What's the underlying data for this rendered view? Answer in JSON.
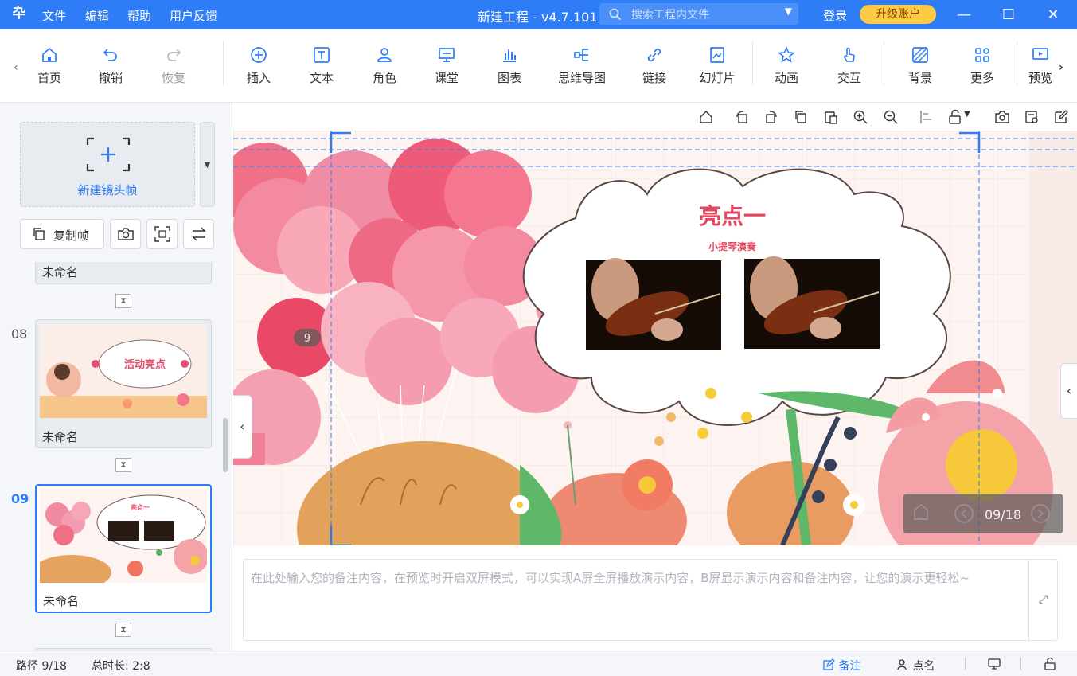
{
  "titlebar": {
    "logo": "卆",
    "menus": [
      "文件",
      "编辑",
      "帮助",
      "用户反馈"
    ],
    "title": "新建工程 - v4.7.101",
    "search_placeholder": "搜索工程内文件",
    "login": "登录",
    "upgrade": "升级账户",
    "accent": "#2e7cf6"
  },
  "toolbar": {
    "items": [
      {
        "label": "首页",
        "icon": "home-icon"
      },
      {
        "label": "撤销",
        "icon": "undo-icon"
      },
      {
        "label": "恢复",
        "icon": "redo-icon"
      },
      {
        "label": "插入",
        "icon": "plus-circle-icon"
      },
      {
        "label": "文本",
        "icon": "text-icon"
      },
      {
        "label": "角色",
        "icon": "character-icon"
      },
      {
        "label": "课堂",
        "icon": "classroom-icon"
      },
      {
        "label": "图表",
        "icon": "chart-icon"
      },
      {
        "label": "思维导图",
        "icon": "mindmap-icon"
      },
      {
        "label": "链接",
        "icon": "link-icon"
      },
      {
        "label": "幻灯片",
        "icon": "slides-icon"
      },
      {
        "label": "动画",
        "icon": "star-animation-icon"
      },
      {
        "label": "交互",
        "icon": "touch-icon"
      },
      {
        "label": "背景",
        "icon": "background-icon"
      },
      {
        "label": "更多",
        "icon": "more-grid-icon"
      },
      {
        "label": "预览",
        "icon": "preview-icon"
      }
    ]
  },
  "left_panel": {
    "new_frame": "新建镜头帧",
    "copy_frame": "复制帧",
    "slides": [
      {
        "num": "",
        "name": "未命名"
      },
      {
        "num": "08",
        "name": "未命名",
        "thumb_title": "活动亮点"
      },
      {
        "num": "09",
        "name": "未命名",
        "thumb_title": "亮点一"
      }
    ]
  },
  "canvas": {
    "frame_badge": "9",
    "cloud_title": "亮点一",
    "cloud_subtitle": "小提琴演奏",
    "page_indicator": "09/18"
  },
  "notes": {
    "placeholder": "在此处输入您的备注内容，在预览时开启双屏模式，可以实现A屏全屏播放演示内容，B屏显示演示内容和备注内容，让您的演示更轻松~"
  },
  "status": {
    "path": "路径 9/18",
    "duration": "总时长: 2:8",
    "notes_btn": "备注",
    "rollcall_btn": "点名"
  }
}
